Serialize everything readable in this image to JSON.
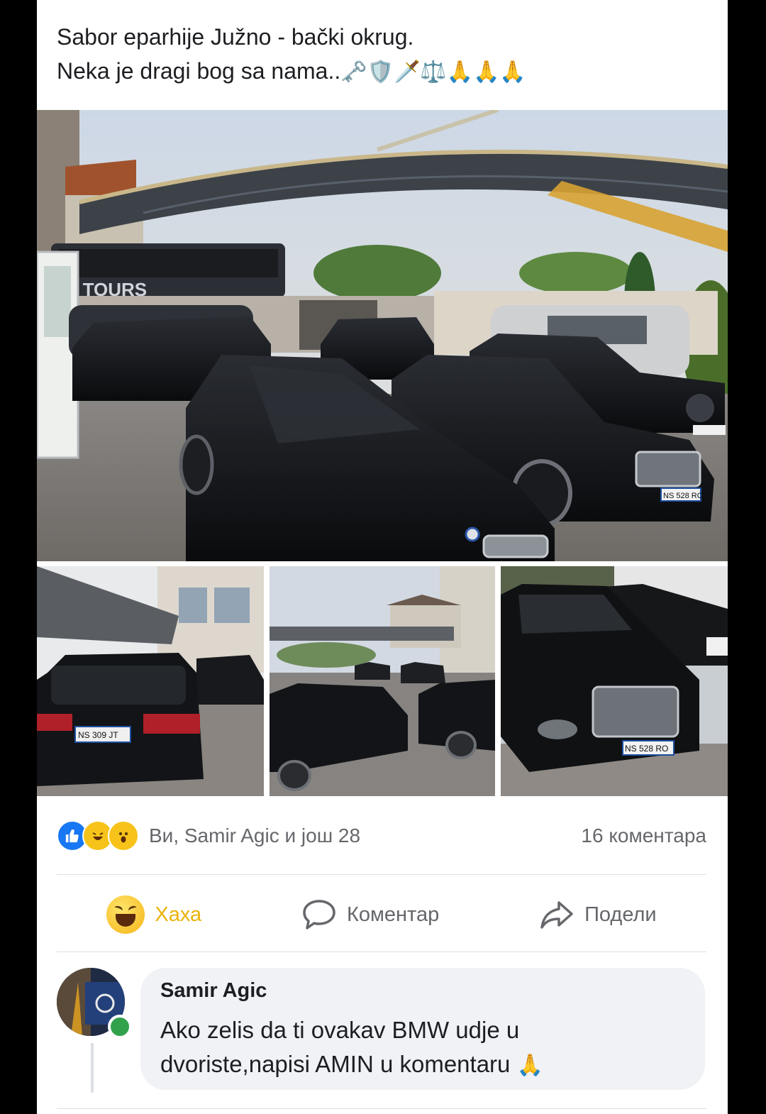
{
  "post": {
    "text_line1": "Sabor eparhije Južno - bački okrug.",
    "text_line2": "Neka je dragi bog sa nama..",
    "text_emojis": "🗝️🛡️🗡️⚖️🙏🙏🙏"
  },
  "photos": {
    "main_alt": "Black cars parked under a curved carport",
    "thumb1_alt": "Black BMW X5 rear view",
    "thumb2_alt": "Cars parked in courtyard",
    "thumb3_alt": "Black Mercedes sedan front view",
    "plate_main": "NS 528 RO",
    "plate_thumb1": "NS 309 JT",
    "plate_thumb3": "NS 528 RO",
    "bus_sign": "S TOURS"
  },
  "reactions": {
    "like_icon": "like-icon",
    "haha_icon": "haha-icon",
    "wow_icon": "wow-icon",
    "names": "Ви, Samir Agic и још 28",
    "comments": "16 коментара"
  },
  "actions": {
    "haha_label": "Хаха",
    "comment_label": "Коментар",
    "share_label": "Подели",
    "haha_color": "#eab308"
  },
  "comment": {
    "author": "Samir Agic",
    "line1": "Ako zelis da ti ovakav BMW udje u",
    "line2": "dvoriste,napisi AMIN u komentaru",
    "emoji": "🙏",
    "online_color": "#31a24c"
  }
}
